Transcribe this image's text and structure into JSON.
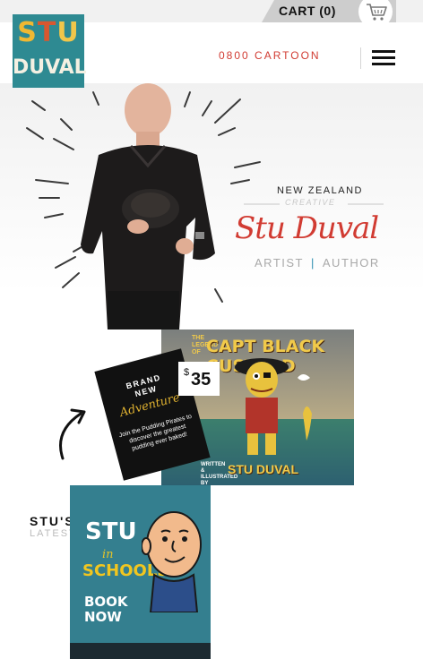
{
  "colors": {
    "brand_red": "#d13b32",
    "teal": "#2e8a92",
    "roles_separator": "#2f8fb0"
  },
  "cart": {
    "label": "CART (0)",
    "icon": "shopping-cart-icon"
  },
  "header": {
    "logo": {
      "line1": "STU",
      "line2": "DUVAL"
    },
    "phone": "0800 CARTOON",
    "menu_icon": "hamburger-menu-icon"
  },
  "hero": {
    "country": "NEW ZEALAND",
    "tagline": "CREATIVE",
    "name": "Stu Duval",
    "role1": "ARTIST",
    "separator": "|",
    "role2": "AUTHOR"
  },
  "promo": {
    "title_small": "THE LEGEND OF",
    "title": "CAPT BLACK CUSTARD",
    "credit_small": "WRITTEN & ILLUSTRATED BY",
    "credit": "STU DUVAL",
    "card_line1": "BRAND",
    "card_line2": "NEW",
    "card_script": "Adventure",
    "card_text": "Join the Pudding Pirates to discover the greatest pudding ever baked!",
    "price_currency": "$",
    "price_value": "35"
  },
  "latest": {
    "title": "STU'S",
    "subtitle": "LATEST"
  },
  "schools": {
    "line1": "STU",
    "line2": "in",
    "line3": "SCHOOLS",
    "line4": "BOOK",
    "line5": "NOW"
  }
}
